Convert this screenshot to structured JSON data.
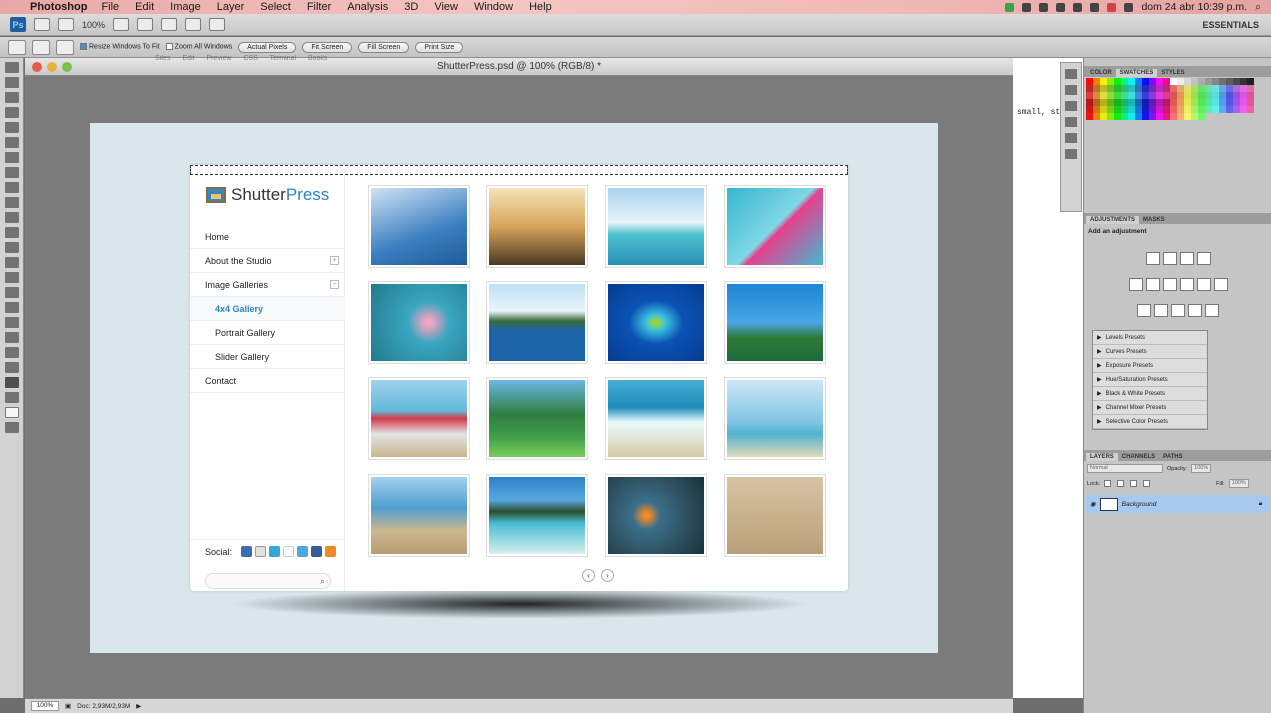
{
  "menubar": {
    "app_name": "Photoshop",
    "items": [
      "File",
      "Edit",
      "Image",
      "Layer",
      "Select",
      "Filter",
      "Analysis",
      "3D",
      "View",
      "Window",
      "Help"
    ],
    "clock": "dom 24 abr  10:39 p.m."
  },
  "appbar": {
    "badge": "Ps",
    "zoom": "100%",
    "workspace": "ESSENTIALS"
  },
  "options": {
    "resize_windows": "Resize Windows To Fit",
    "zoom_all": "Zoom All Windows",
    "actual_pixels": "Actual Pixels",
    "fit_screen": "Fit Screen",
    "fill_screen": "Fill Screen",
    "print_size": "Print Size"
  },
  "document": {
    "title": "ShutterPress.psd @ 100% (RGB/8) *",
    "ghost_text": "Sites Edit Preview CSS Terminal Books"
  },
  "site": {
    "logo_main": "Shutter",
    "logo_accent": "Press",
    "nav": [
      {
        "label": "Home"
      },
      {
        "label": "About the Studio",
        "toggle": "+"
      },
      {
        "label": "Image Galleries",
        "toggle": "−"
      },
      {
        "label": "4x4 Gallery",
        "active": true
      },
      {
        "label": "Portrait Gallery"
      },
      {
        "label": "Slider Gallery"
      },
      {
        "label": "Contact"
      }
    ],
    "social_label": "Social:",
    "pager_prev": "‹",
    "pager_next": "›"
  },
  "code_text": "small, st",
  "panels": {
    "color_tabs": [
      "COLOR",
      "SWATCHES",
      "STYLES"
    ],
    "adj_tabs": [
      "ADJUSTMENTS",
      "MASKS"
    ],
    "adj_title": "Add an adjustment",
    "presets": [
      "Levels Presets",
      "Curves Presets",
      "Exposure Presets",
      "Hue/Saturation Presets",
      "Black & White Presets",
      "Channel Mixer Presets",
      "Selective Color Presets"
    ],
    "layer_tabs": [
      "LAYERS",
      "CHANNELS",
      "PATHS"
    ],
    "blend_mode": "Normal",
    "opacity_label": "Opacity:",
    "opacity_value": "100%",
    "lock_label": "Lock:",
    "fill_label": "Fill:",
    "fill_value": "100%",
    "layer_name": "Background"
  },
  "status": {
    "zoom": "100%",
    "doc": "Doc: 2,93M/2,93M"
  }
}
